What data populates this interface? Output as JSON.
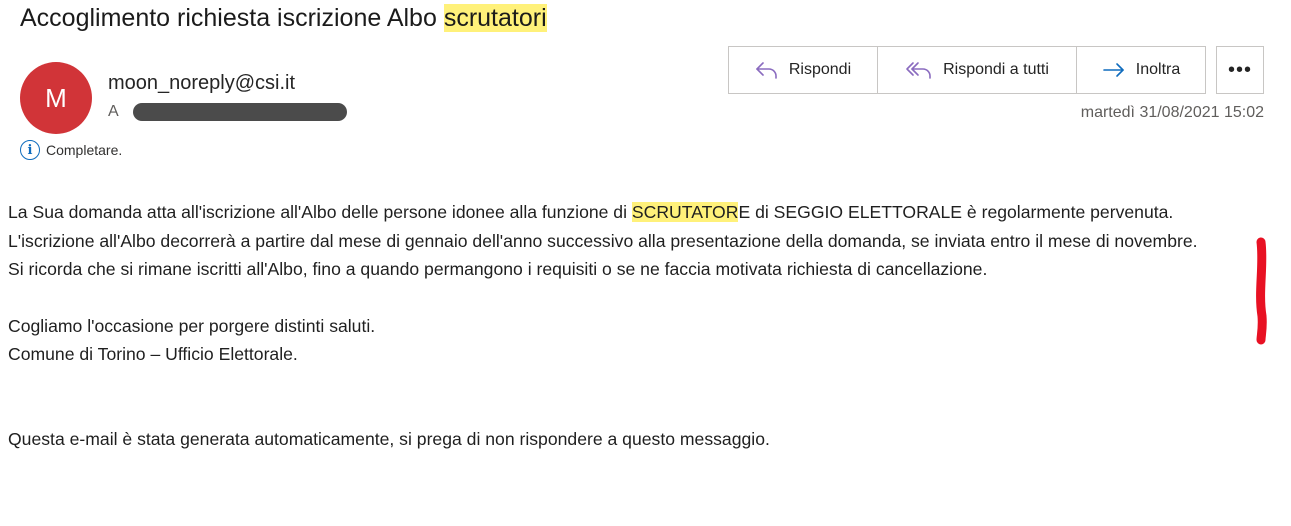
{
  "email": {
    "subject_prefix": "Accoglimento richiesta iscrizione Albo ",
    "subject_highlight": "scrutatori",
    "avatar_initial": "M",
    "sender": "moon_noreply@csi.it",
    "to_label": "A",
    "info_text": "Completare.",
    "date": "martedì 31/08/2021 15:02"
  },
  "actions": {
    "reply": "Rispondi",
    "reply_all": "Rispondi a tutti",
    "forward": "Inoltra",
    "more": "•••"
  },
  "body": {
    "p1_before": "La Sua domanda atta all'iscrizione all'Albo delle persone idonee alla funzione di ",
    "p1_highlight": "SCRUTATOR",
    "p1_after": "E di SEGGIO ELETTORALE è regolarmente pervenuta.",
    "p2": "L'iscrizione all'Albo decorrerà a partire dal mese di gennaio dell'anno successivo alla presentazione della domanda, se inviata entro il mese di novembre.",
    "p3": "Si ricorda che si rimane iscritti all'Albo, fino a quando permangono i requisiti o se ne faccia motivata richiesta di cancellazione.",
    "p4": "Cogliamo l'occasione per porgere distinti saluti.",
    "p5": "Comune di Torino – Ufficio Elettorale.",
    "p6": "Questa e-mail è stata generata automaticamente, si prega di non rispondere a questo messaggio."
  },
  "colors": {
    "avatar": "#d13438",
    "highlight": "#fff17a",
    "accent": "#0f6cbd",
    "reply_icon": "#8a6bbf",
    "annotation": "#e81123"
  },
  "icons": {
    "reply": "reply-arrow-icon",
    "reply_all": "reply-all-arrow-icon",
    "forward": "forward-arrow-icon",
    "info": "info-icon",
    "more": "more-dots-icon"
  }
}
